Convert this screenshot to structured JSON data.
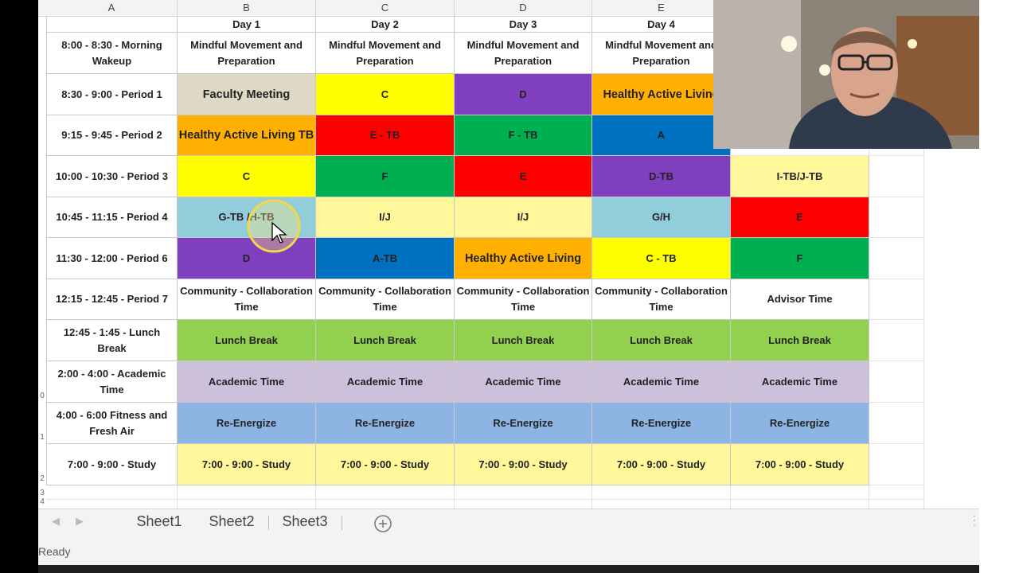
{
  "columns": [
    "A",
    "B",
    "C",
    "D",
    "E"
  ],
  "days": [
    "Day 1",
    "Day 2",
    "Day 3",
    "Day 4"
  ],
  "rows": [
    {
      "time": "8:00 - 8:30 - Morning Wakeup",
      "cells": [
        {
          "text": "Mindful Movement and Preparation",
          "color": "#ffffff"
        },
        {
          "text": "Mindful Movement and Preparation",
          "color": "#ffffff"
        },
        {
          "text": "Mindful Movement and Preparation",
          "color": "#ffffff"
        },
        {
          "text": "Mindful Movement and Preparation",
          "color": "#ffffff"
        },
        {
          "text": "",
          "color": "#ffffff"
        }
      ]
    },
    {
      "time": "8:30 - 9:00 - Period 1",
      "cells": [
        {
          "text": "Faculty Meeting",
          "color": "#ddd9c4",
          "big": true
        },
        {
          "text": "C",
          "color": "#ffff00"
        },
        {
          "text": "D",
          "color": "#7f3fbf"
        },
        {
          "text": "Healthy Active Living",
          "color": "#ffb000",
          "big": true
        },
        {
          "text": "",
          "color": "#ffffff"
        }
      ]
    },
    {
      "time": "9:15 - 9:45 - Period 2",
      "cells": [
        {
          "text": "Healthy Active Living TB",
          "color": "#ffb000",
          "big": true
        },
        {
          "text": "E - TB",
          "color": "#ff0000"
        },
        {
          "text": "F - TB",
          "color": "#00b050"
        },
        {
          "text": "A",
          "color": "#0070c0"
        },
        {
          "text": "",
          "color": "#ffffff"
        }
      ]
    },
    {
      "time": "10:00 - 10:30 - Period 3",
      "cells": [
        {
          "text": "C",
          "color": "#ffff00"
        },
        {
          "text": "F",
          "color": "#00b050"
        },
        {
          "text": "E",
          "color": "#ff0000"
        },
        {
          "text": "D-TB",
          "color": "#7f3fbf"
        },
        {
          "text": "I-TB/J-TB",
          "color": "#fff799"
        }
      ]
    },
    {
      "time": "10:45 - 11:15 - Period 4",
      "cells": [
        {
          "text": "G-TB /H-TB",
          "color": "#92cddc"
        },
        {
          "text": "I/J",
          "color": "#fff799"
        },
        {
          "text": "I/J",
          "color": "#fff799"
        },
        {
          "text": "G/H",
          "color": "#92cddc"
        },
        {
          "text": "E",
          "color": "#ff0000"
        }
      ]
    },
    {
      "time": "11:30 - 12:00 - Period 6",
      "cells": [
        {
          "text": "D",
          "color": "#7f3fbf"
        },
        {
          "text": "A-TB",
          "color": "#0070c0"
        },
        {
          "text": "Healthy Active Living",
          "color": "#ffb000",
          "big": true
        },
        {
          "text": "C - TB",
          "color": "#ffff00"
        },
        {
          "text": "F",
          "color": "#00b050"
        }
      ]
    },
    {
      "time": "12:15 - 12:45 - Period 7",
      "cells": [
        {
          "text": "Community - Collaboration Time",
          "color": "#ffffff"
        },
        {
          "text": "Community - Collaboration Time",
          "color": "#ffffff"
        },
        {
          "text": "Community - Collaboration Time",
          "color": "#ffffff"
        },
        {
          "text": "Community - Collaboration Time",
          "color": "#ffffff"
        },
        {
          "text": "Advisor Time",
          "color": "#ffffff"
        }
      ]
    },
    {
      "time": "12:45 - 1:45 - Lunch Break",
      "cells": [
        {
          "text": "Lunch Break",
          "color": "#92d050"
        },
        {
          "text": "Lunch Break",
          "color": "#92d050"
        },
        {
          "text": "Lunch Break",
          "color": "#92d050"
        },
        {
          "text": "Lunch Break",
          "color": "#92d050"
        },
        {
          "text": "Lunch Break",
          "color": "#92d050"
        }
      ]
    },
    {
      "time": "2:00 - 4:00 - Academic Time",
      "cells": [
        {
          "text": "Academic Time",
          "color": "#ccc0da"
        },
        {
          "text": "Academic Time",
          "color": "#ccc0da"
        },
        {
          "text": "Academic Time",
          "color": "#ccc0da"
        },
        {
          "text": "Academic Time",
          "color": "#ccc0da"
        },
        {
          "text": "Academic Time",
          "color": "#ccc0da"
        }
      ]
    },
    {
      "time": "4:00 - 6:00 Fitness and Fresh Air",
      "cells": [
        {
          "text": "Re-Energize",
          "color": "#8db4e2"
        },
        {
          "text": "Re-Energize",
          "color": "#8db4e2"
        },
        {
          "text": "Re-Energize",
          "color": "#8db4e2"
        },
        {
          "text": "Re-Energize",
          "color": "#8db4e2"
        },
        {
          "text": "Re-Energize",
          "color": "#8db4e2"
        }
      ]
    },
    {
      "time": "7:00 - 9:00 - Study",
      "cells": [
        {
          "text": "7:00 - 9:00 - Study",
          "color": "#fff799"
        },
        {
          "text": "7:00 - 9:00 - Study",
          "color": "#fff799"
        },
        {
          "text": "7:00 - 9:00 - Study",
          "color": "#fff799"
        },
        {
          "text": "7:00 - 9:00 - Study",
          "color": "#fff799"
        },
        {
          "text": "7:00 - 9:00 - Study",
          "color": "#fff799"
        }
      ]
    }
  ],
  "row_numbers": [
    "0",
    "1",
    "2",
    "3",
    "4"
  ],
  "sheets": [
    "Sheet1",
    "Sheet2",
    "Sheet3"
  ],
  "active_sheet": "Sheet1",
  "status": "Ready",
  "icons": {
    "prev": "triangle-left-icon",
    "next": "triangle-right-icon",
    "add": "plus-circle-icon",
    "options": "vertical-dots-icon"
  }
}
